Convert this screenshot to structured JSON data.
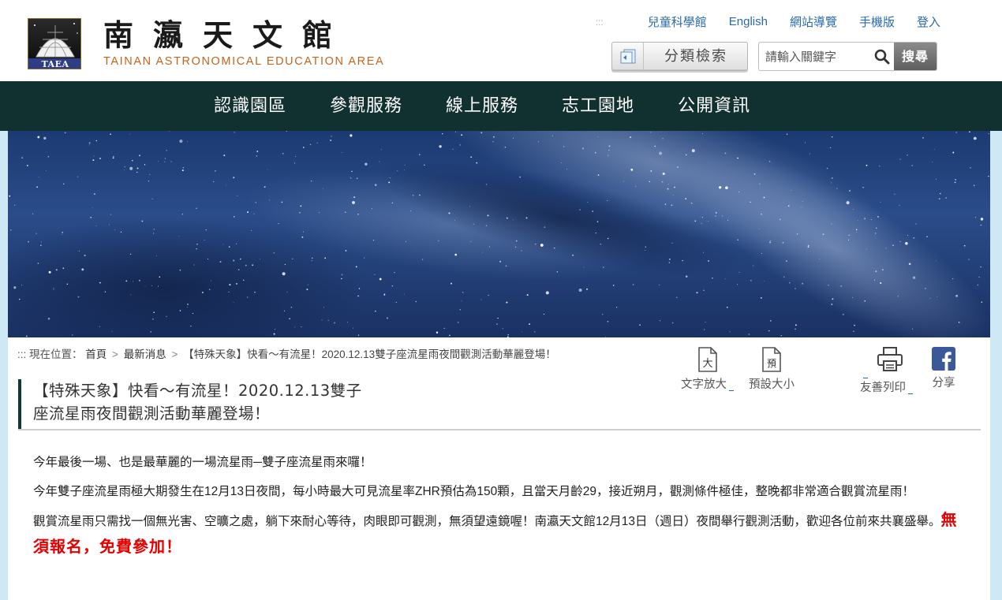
{
  "site": {
    "logo_badge": "TAEA",
    "title_zh": "南瀛天文館",
    "title_en": "TAINAN ASTRONOMICAL EDUCATION AREA"
  },
  "toplinks": {
    "accesskey": ":::",
    "items": [
      "兒童科學館",
      "English",
      "網站導覽",
      "手機版",
      "登入"
    ]
  },
  "category_search": {
    "label": "分類檢索"
  },
  "search": {
    "placeholder": "請輸入關鍵字",
    "button": "搜尋"
  },
  "nav": {
    "items": [
      "認識園區",
      "參觀服務",
      "線上服務",
      "志工園地",
      "公開資訊"
    ]
  },
  "breadcrumb": {
    "prefix": "::: 現在位置：",
    "home": "首頁",
    "section": "最新消息",
    "separator": ">",
    "current": "【特殊天象】快看～有流星！2020.12.13雙子座流星雨夜間觀測活動華麗登場！"
  },
  "tools": {
    "enlarge": {
      "label": "文字放大",
      "glyph": "大",
      "icon": "text-enlarge-icon"
    },
    "default": {
      "label": "預設大小",
      "glyph": "預",
      "icon": "default-size-icon"
    },
    "print": {
      "label": "友善列印",
      "icon": "printer-icon"
    },
    "share": {
      "label": "分享",
      "icon": "facebook-icon"
    }
  },
  "article": {
    "title_line1": "【特殊天象】快看～有流星！2020.12.13雙子",
    "title_line2": "座流星雨夜間觀測活動華麗登場！",
    "p1": "今年最後一場、也是最華麗的一場流星雨─雙子座流星雨來囉！",
    "p2": "今年雙子座流星雨極大期發生在12月13日夜間，每小時最大可見流星率ZHR預估為150顆，且當天月齡29，接近朔月，觀測條件極佳，整晚都非常適合觀賞流星雨！",
    "p3": "觀賞流星雨只需找一個無光害、空曠之處，躺下來耐心等待，肉眼即可觀測，無須望遠鏡喔！南瀛天文館12月13日（週日）夜間舉行觀測活動，歡迎各位前來共襄盛舉。",
    "p3_highlight": "無須報名，免費參加！"
  },
  "colors": {
    "nav_bg": "#113130",
    "link": "#2a6aa8",
    "subtitle": "#c1651d",
    "highlight": "#e60000",
    "frame": "#cfe8f6"
  }
}
